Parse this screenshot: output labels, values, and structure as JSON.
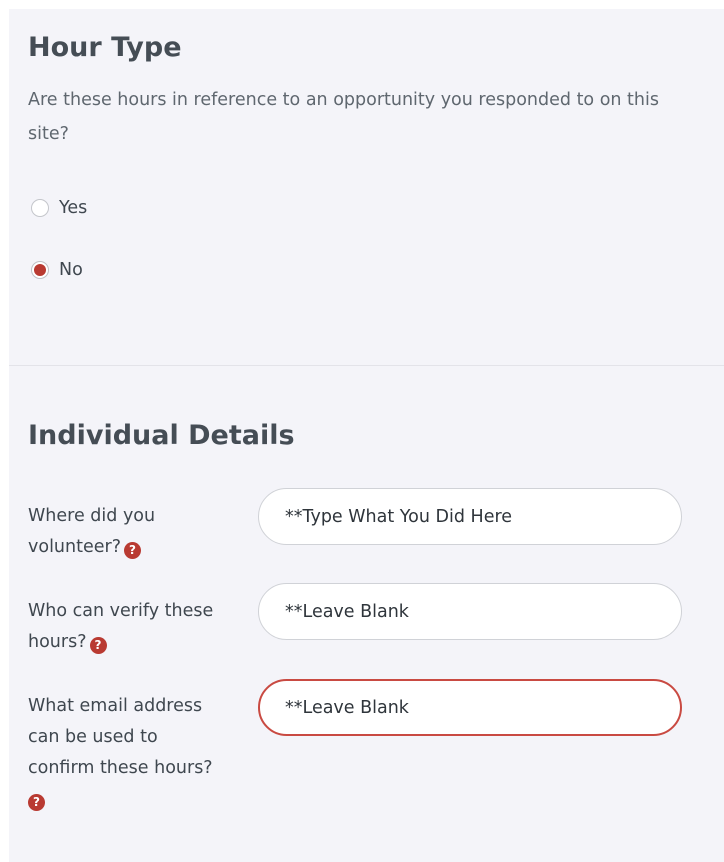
{
  "hour_type": {
    "title": "Hour Type",
    "question": "Are these hours in reference to an opportunity you responded to on this site?",
    "options": [
      {
        "label": "Yes",
        "selected": false
      },
      {
        "label": "No",
        "selected": true
      }
    ]
  },
  "individual_details": {
    "title": "Individual Details",
    "fields": [
      {
        "label": "Where did you volunteer?",
        "value": "**Type What You Did Here"
      },
      {
        "label": "Who can verify these hours?",
        "value": "**Leave Blank"
      },
      {
        "label": "What email address can be used to confirm these hours?",
        "value": "**Leave Blank"
      }
    ],
    "help_glyph": "?"
  },
  "colors": {
    "accent": "#b93a32",
    "panel_background": "#f4f4f9",
    "focus_border": "#c94a42"
  },
  "icons": {
    "help": "question-circle-icon"
  }
}
